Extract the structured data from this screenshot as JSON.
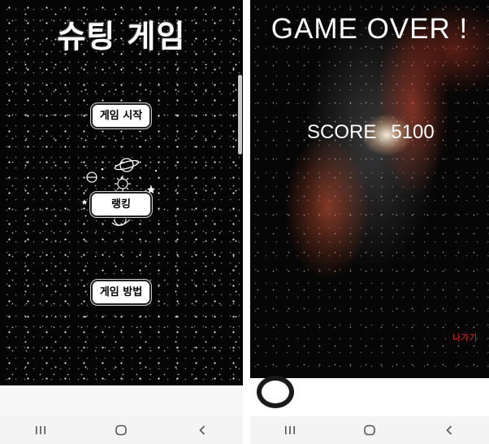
{
  "menu_screen": {
    "title": "슈팅 게임",
    "buttons": {
      "start": "게임 시작",
      "ranking": "랭킹",
      "how_to": "게임 방법"
    },
    "doodle_icons": [
      "planet-icon",
      "sun-icon",
      "star-icon"
    ]
  },
  "game_over_screen": {
    "title": "GAME OVER !",
    "score_label": "SCORE",
    "score_value": "5100",
    "exit_label": "나가기",
    "exit_color": "#e02a22"
  },
  "navigation_bar": {
    "icons": [
      "recent-apps-icon",
      "home-icon",
      "back-icon"
    ]
  }
}
